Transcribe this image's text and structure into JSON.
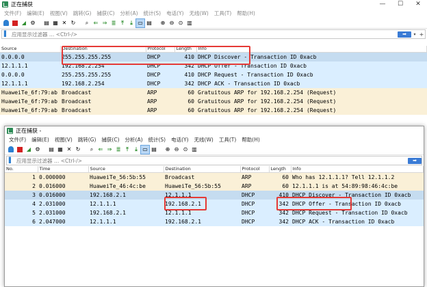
{
  "back_window": {
    "title": "正在捕获",
    "menu": [
      "文件(F)",
      "编辑(E)",
      "视图(V)",
      "跳转(G)",
      "捕获(C)",
      "分析(A)",
      "统计(S)",
      "电话(Y)",
      "无线(W)",
      "工具(T)",
      "帮助(H)"
    ],
    "filter_placeholder": "应用显示过滤器 … <Ctrl-/>",
    "columns": [
      "Source",
      "Destination",
      "Protocol",
      "Length",
      "Info"
    ],
    "rows": [
      {
        "source": "0.0.0.0",
        "destination": "255.255.255.255",
        "protocol": "DHCP",
        "length": "410",
        "info": "DHCP Discover  - Transaction ID 0xacb",
        "type": "sel"
      },
      {
        "source": "12.1.1.1",
        "destination": "192.168.2.254",
        "protocol": "DHCP",
        "length": "342",
        "info": "DHCP Offer     - Transaction ID 0xacb",
        "type": "udp"
      },
      {
        "source": "0.0.0.0",
        "destination": "255.255.255.255",
        "protocol": "DHCP",
        "length": "410",
        "info": "DHCP Request   - Transaction ID 0xacb",
        "type": "udp"
      },
      {
        "source": "12.1.1.1",
        "destination": "192.168.2.254",
        "protocol": "DHCP",
        "length": "342",
        "info": "DHCP ACK       - Transaction ID 0xacb",
        "type": "udp"
      },
      {
        "source": "HuaweiTe_6f:79:ab",
        "destination": "Broadcast",
        "protocol": "ARP",
        "length": "60",
        "info": "Gratuitous ARP for 192.168.2.254 (Request)",
        "type": "arp"
      },
      {
        "source": "HuaweiTe_6f:79:ab",
        "destination": "Broadcast",
        "protocol": "ARP",
        "length": "60",
        "info": "Gratuitous ARP for 192.168.2.254 (Request)",
        "type": "arp"
      },
      {
        "source": "HuaweiTe_6f:79:ab",
        "destination": "Broadcast",
        "protocol": "ARP",
        "length": "60",
        "info": "Gratuitous ARP for 192.168.2.254 (Request)",
        "type": "arp"
      }
    ]
  },
  "front_window": {
    "title": "正在捕获 -",
    "menu": [
      "文件(F)",
      "编辑(E)",
      "视图(V)",
      "跳转(G)",
      "捕获(C)",
      "分析(A)",
      "统计(S)",
      "电话(Y)",
      "无线(W)",
      "工具(T)",
      "帮助(H)"
    ],
    "filter_placeholder": "应用显示过滤器 … <Ctrl-/>",
    "columns": [
      "No.",
      "Time",
      "Source",
      "Destination",
      "Protocol",
      "Length",
      "Info"
    ],
    "rows": [
      {
        "no": "1",
        "time": "0.000000",
        "source": "HuaweiTe_56:5b:55",
        "destination": "Broadcast",
        "protocol": "ARP",
        "length": "60",
        "info": "Who has 12.1.1.1? Tell 12.1.1.2",
        "type": "arp"
      },
      {
        "no": "2",
        "time": "0.016000",
        "source": "HuaweiTe_46:4c:be",
        "destination": "HuaweiTe_56:5b:55",
        "protocol": "ARP",
        "length": "60",
        "info": "12.1.1.1 is at 54:89:98:46:4c:be",
        "type": "arp"
      },
      {
        "no": "3",
        "time": "0.016000",
        "source": "192.168.2.1",
        "destination": "12.1.1.1",
        "protocol": "DHCP",
        "length": "410",
        "info": "DHCP Discover  - Transaction ID 0xacb",
        "type": "sel"
      },
      {
        "no": "4",
        "time": "2.031000",
        "source": "12.1.1.1",
        "destination": "192.168.2.1",
        "protocol": "DHCP",
        "length": "342",
        "info": "DHCP Offer     - Transaction ID 0xacb",
        "type": "udp"
      },
      {
        "no": "5",
        "time": "2.031000",
        "source": "192.168.2.1",
        "destination": "12.1.1.1",
        "protocol": "DHCP",
        "length": "342",
        "info": "DHCP Request   - Transaction ID 0xacb",
        "type": "udp"
      },
      {
        "no": "6",
        "time": "2.047000",
        "source": "12.1.1.1",
        "destination": "192.168.2.1",
        "protocol": "DHCP",
        "length": "342",
        "info": "DHCP ACK       - Transaction ID 0xacb",
        "type": "udp"
      }
    ]
  },
  "colors": {
    "highlight_box": "#e53935",
    "udp_row": "#daeeff",
    "arp_row": "#faf0d7",
    "selected_row": "#c5dcf0"
  }
}
